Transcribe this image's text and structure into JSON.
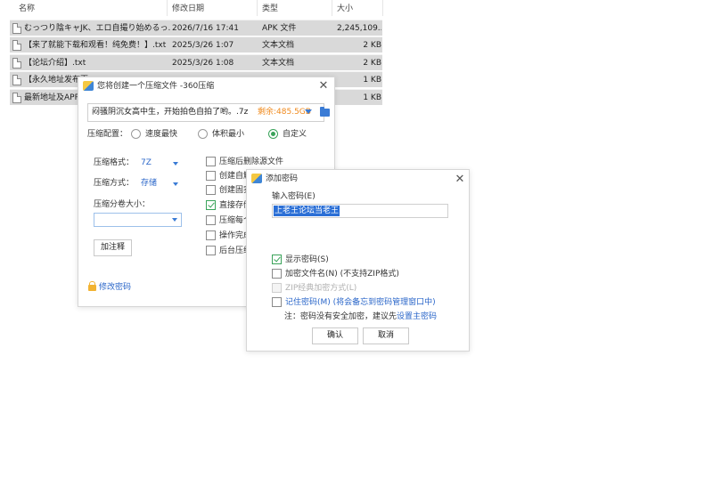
{
  "file_list": {
    "columns": [
      "名称",
      "修改日期",
      "类型",
      "大小"
    ],
    "rows": [
      {
        "name": "むっつり陰キャJK、エロ自撮り始めるっ...",
        "date": "2026/7/16 17:41",
        "type": "APK 文件",
        "size": "2,245,109..."
      },
      {
        "name": "【来了就能下载和观看！纯免费！】.txt",
        "date": "2025/3/26 1:07",
        "type": "文本文档",
        "size": "2 KB"
      },
      {
        "name": "【论坛介绍】.txt",
        "date": "2025/3/26 1:08",
        "type": "文本文档",
        "size": "2 KB"
      },
      {
        "name": "【永久地址发布页",
        "date": "",
        "type": "",
        "size": "1 KB"
      },
      {
        "name": "最新地址及APP",
        "date": "",
        "type": "",
        "size": "1 KB"
      }
    ]
  },
  "compress_dialog": {
    "title": "您将创建一个压缩文件 -360压缩",
    "path": "闷骚阴沉女高中生，开始拍色自拍了哟。.7z",
    "free_space": "剩余:485.5GB",
    "config_label": "压缩配置：",
    "config_options": [
      "速度最快",
      "体积最小",
      "自定义"
    ],
    "config_selected": "自定义",
    "format_label": "压缩格式：",
    "format_value": "7Z",
    "method_label": "压缩方式：",
    "method_value": "存储",
    "split_label": "压缩分卷大小：",
    "split_value": "",
    "comment_button": "加注释",
    "options": [
      {
        "label": "压缩后删除源文件",
        "checked": false
      },
      {
        "label": "创建自解",
        "checked": false
      },
      {
        "label": "创建固实",
        "checked": false
      },
      {
        "label": "直接存储",
        "checked": true
      },
      {
        "label": "压缩每个",
        "checked": false
      },
      {
        "label": "操作完成",
        "checked": false
      },
      {
        "label": "后台压缩",
        "checked": false
      }
    ],
    "change_password_link": "修改密码"
  },
  "password_dialog": {
    "title": "添加密码",
    "input_label": "输入密码(E)",
    "password_value": "上老王论坛当老王",
    "show_password": "显示密码(S)",
    "show_password_checked": true,
    "encrypt_names": "加密文件名(N) (不支持ZIP格式)",
    "zip_classic": "ZIP经典加密方式(L)",
    "remember_main": "记住密码(M)",
    "remember_note": "(将会备忘到密码管理窗口中)",
    "note_prefix": "注：密码没有安全加密，建议先",
    "note_link": "设置主密码",
    "ok_button": "确认",
    "cancel_button": "取消"
  },
  "colors": {
    "accent_blue": "#2a66c9",
    "check_green": "#3aa35a",
    "free_space_orange": "#f08a1d",
    "selected_row": "#d9d9d9"
  }
}
